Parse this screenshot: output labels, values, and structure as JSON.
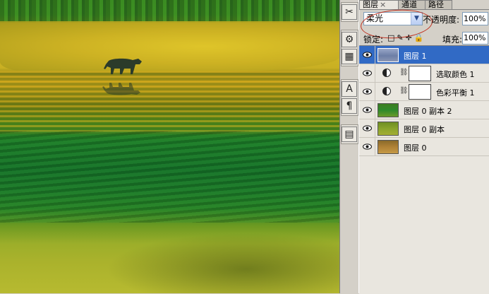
{
  "tools": {
    "items": [
      {
        "name": "brush-settings-icon",
        "glyph": "✂"
      },
      {
        "name": "clone-source-icon",
        "glyph": "⚙"
      },
      {
        "name": "tool-presets-icon",
        "glyph": "▦"
      },
      {
        "name": "character-icon",
        "glyph": "A"
      },
      {
        "name": "paragraph-icon",
        "glyph": "¶"
      },
      {
        "name": "notes-icon",
        "glyph": "▤"
      }
    ]
  },
  "panel": {
    "tabs": [
      {
        "label": "图层",
        "close": "×",
        "active": true
      },
      {
        "label": "通道",
        "active": false
      },
      {
        "label": "路径",
        "active": false
      }
    ],
    "blend_mode": "柔光",
    "opacity_label": "不透明度:",
    "opacity_value": "100%",
    "lock_label": "锁定:",
    "lock_icons": [
      "□",
      "✎",
      "✛",
      "🔒"
    ],
    "fill_label": "填充:",
    "fill_value": "100%",
    "layers": [
      {
        "name": "图层 1",
        "kind": "pixel",
        "selected": true,
        "thumb_color": "#7c8fb5"
      },
      {
        "name": "选取颜色 1",
        "kind": "adjustment",
        "selected": false
      },
      {
        "name": "色彩平衡 1",
        "kind": "adjustment",
        "selected": false
      },
      {
        "name": "图层 0 副本 2",
        "kind": "pixel",
        "selected": false,
        "thumb_color": "#2f8a2b"
      },
      {
        "name": "图层 0 副本",
        "kind": "pixel",
        "selected": false,
        "thumb_color": "#7a9a2a"
      },
      {
        "name": "图层 0",
        "kind": "pixel",
        "selected": false,
        "thumb_color": "#a67a2e"
      }
    ]
  },
  "colors": {
    "selection": "#316ac5",
    "annotation": "#c0301f"
  }
}
